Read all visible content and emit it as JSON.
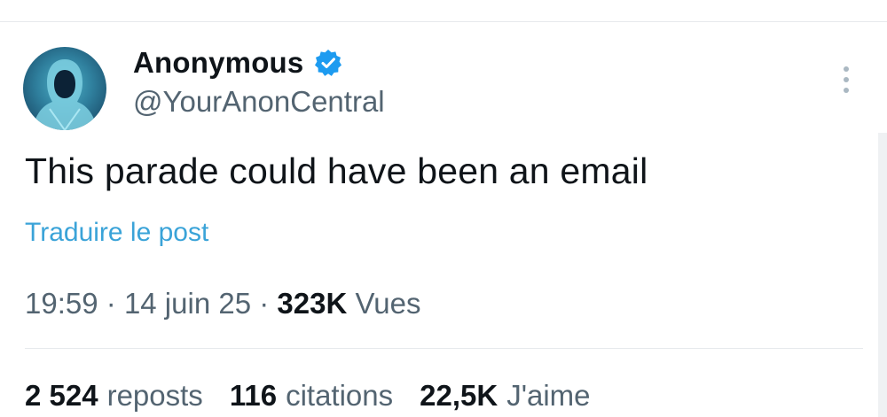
{
  "author": {
    "name": "Anonymous",
    "handle": "@YourAnonCentral",
    "verified": true
  },
  "post": {
    "text": "This parade could have been an email",
    "translate_label": "Traduire le post"
  },
  "meta": {
    "time": "19:59",
    "separator": "·",
    "date": "14 juin 25",
    "views_count": "323K",
    "views_label": "Vues"
  },
  "stats": [
    {
      "count": "2 524",
      "label": "reposts"
    },
    {
      "count": "116",
      "label": "citations"
    },
    {
      "count": "22,5K",
      "label": "J'aime"
    }
  ],
  "colors": {
    "link": "#3aa3d8",
    "verified_badge": "#1d9bf0",
    "secondary_text": "#536471",
    "primary_text": "#0f1419"
  },
  "icons": {
    "verified": "verified-badge-icon",
    "more": "more-vertical-icon",
    "avatar": "hooded-figure-avatar"
  }
}
